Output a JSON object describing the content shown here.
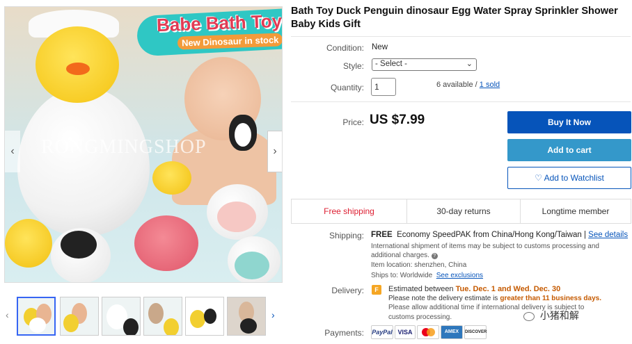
{
  "product": {
    "title": "Bath Toy Duck Penguin dinosaur Egg Water Spray Sprinkler Shower Baby Kids Gift"
  },
  "image": {
    "banner_title": "Babe Bath Toy",
    "banner_subtitle": "New Dinosaur in stock",
    "watermark": "RONGMINGSHOP",
    "prev_arrow": "‹",
    "next_arrow": "›"
  },
  "thumbnails": {
    "prev": "‹",
    "next": "›"
  },
  "condition": {
    "label": "Condition:",
    "value": "New"
  },
  "style": {
    "label": "Style:",
    "selected": "- Select -"
  },
  "quantity": {
    "label": "Quantity:",
    "value": "1",
    "available": "6 available /",
    "sold": "1 sold"
  },
  "price": {
    "label": "Price:",
    "value": "US $7.99"
  },
  "buttons": {
    "buy_now": "Buy It Now",
    "add_to_cart": "Add to cart",
    "watchlist": "♡ Add to Watchlist"
  },
  "features": {
    "shipping": "Free shipping",
    "returns": "30-day returns",
    "member": "Longtime member"
  },
  "shipping": {
    "label": "Shipping:",
    "free": "FREE",
    "method": "Economy SpeedPAK from China/Hong Kong/Taiwan |",
    "details_link": "See details",
    "intl_note_1": "International shipment of items may be subject to customs processing and",
    "intl_note_2": "additional charges.",
    "location": "Item location: shenzhen, China",
    "ships_to": "Ships to: Worldwide",
    "exclusions_link": "See exclusions"
  },
  "delivery": {
    "label": "Delivery:",
    "estimated_prefix": "Estimated between",
    "estimated_dates": "Tue. Dec. 1 and Wed. Dec. 30",
    "note_prefix": "Please note the delivery estimate is",
    "note_highlight": "greater than 11 business days.",
    "note2": "Please allow additional time if international delivery is subject to",
    "note3": "customs processing."
  },
  "payments": {
    "label": "Payments:",
    "methods": [
      "PayPal",
      "VISA",
      "MC",
      "AMEX",
      "DISCOVER"
    ]
  },
  "watermark_overlay": "小猪和解",
  "colors": {
    "primary_blue": "#0654ba",
    "cart_blue": "#3498ca",
    "free_shipping_red": "#dd1e31",
    "highlight_orange": "#c55a00"
  }
}
